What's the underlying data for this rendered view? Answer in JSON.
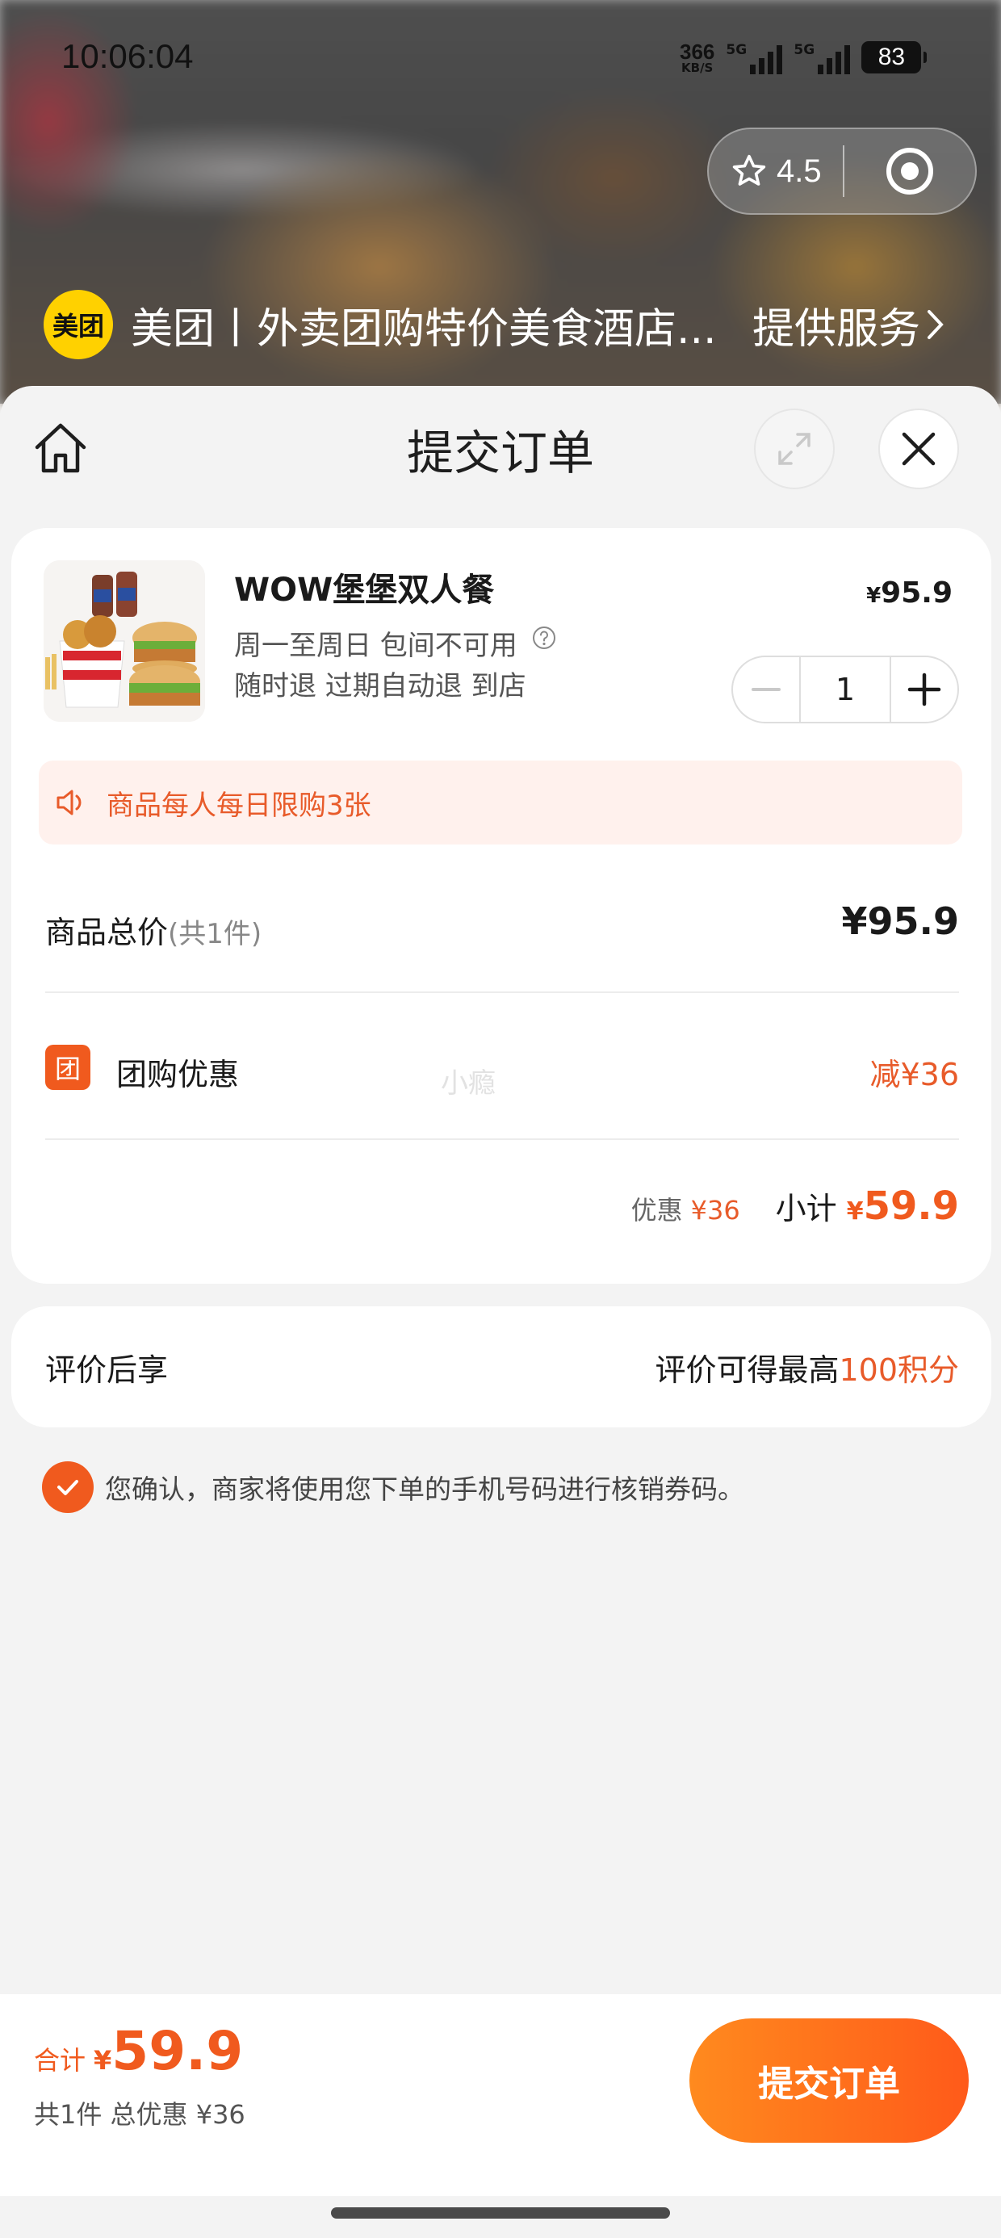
{
  "status_bar": {
    "time": "10:06:04",
    "net_speed": "366",
    "net_unit": "KB/S",
    "signal1_label": "5G",
    "signal2_label": "5G",
    "battery": "83"
  },
  "capsule": {
    "rating": "4.5"
  },
  "provider": {
    "logo_text": "美团",
    "name": "美团丨外卖团购特价美食酒店...",
    "service_label": "提供服务"
  },
  "header": {
    "title": "提交订单"
  },
  "product": {
    "title": "WOW堡堡双人餐",
    "line1": "周一至周日 包间不可用",
    "line2": "随时退 过期自动退 到店",
    "price_symbol": "¥",
    "price": "95.9",
    "quantity": "1"
  },
  "notice": {
    "text": "商品每人每日限购3张"
  },
  "totals": {
    "goods_label": "商品总价",
    "goods_count": "(共1件)",
    "goods_total": "¥95.9",
    "group_icon": "团",
    "group_label": "团购优惠",
    "group_discount": "减¥36",
    "watermark": "小瘾",
    "discount_label": "优惠",
    "discount_value": "¥36",
    "subtotal_label": "小计",
    "subtotal_symbol": "¥",
    "subtotal_value": "59.9"
  },
  "review": {
    "label": "评价后享",
    "text_prefix": "评价可得最高",
    "points": "100积分"
  },
  "consent": {
    "text": "您确认，商家将使用您下单的手机号码进行核销券码。"
  },
  "footer": {
    "total_label": "合计",
    "total_symbol": "¥",
    "total_value": "59.9",
    "summary": "共1件 总优惠 ¥36",
    "submit_label": "提交订单"
  },
  "colors": {
    "accent": "#f05a1e",
    "brand_yellow": "#ffd100"
  }
}
